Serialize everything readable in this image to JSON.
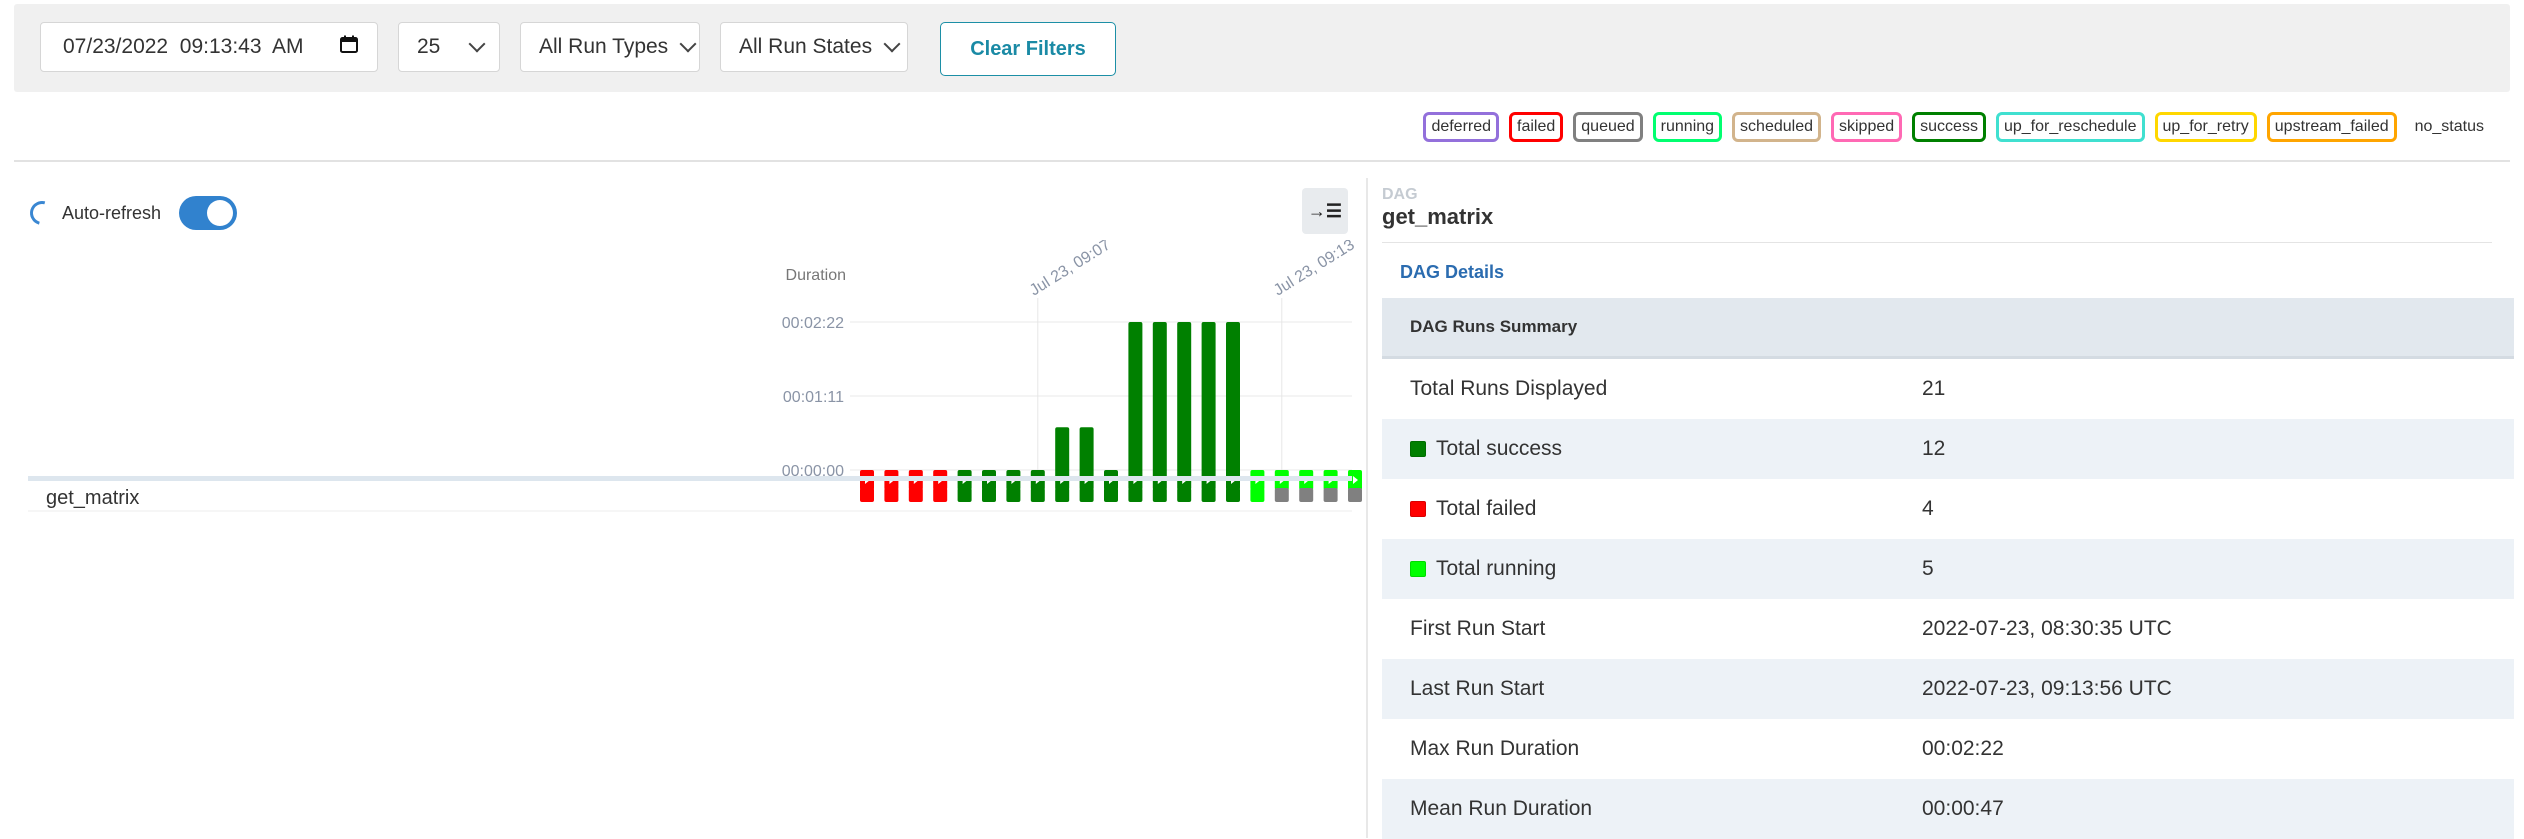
{
  "filters": {
    "execution_date": "07/23/2022  09:13:43  AM",
    "num_runs": "25",
    "run_type": "All Run Types",
    "run_state": "All Run States",
    "clear_label": "Clear Filters"
  },
  "legend": [
    {
      "label": "deferred",
      "color": "#9370db"
    },
    {
      "label": "failed",
      "color": "#ff0000"
    },
    {
      "label": "queued",
      "color": "#808080"
    },
    {
      "label": "running",
      "color": "#01ff70"
    },
    {
      "label": "scheduled",
      "color": "#d2b48c"
    },
    {
      "label": "skipped",
      "color": "#ff69b4"
    },
    {
      "label": "success",
      "color": "#008000"
    },
    {
      "label": "up_for_reschedule",
      "color": "#40e0d0"
    },
    {
      "label": "up_for_retry",
      "color": "#ffd700"
    },
    {
      "label": "upstream_failed",
      "color": "#ffa500"
    },
    {
      "label": "no_status",
      "color": ""
    }
  ],
  "auto_refresh": {
    "label": "Auto-refresh",
    "enabled": true
  },
  "grid": {
    "duration_label": "Duration",
    "y_ticks": [
      "00:02:22",
      "00:01:11",
      "00:00:00"
    ],
    "date_labels": [
      {
        "text": "Jul 23, 09:07",
        "run_index": 7
      },
      {
        "text": "Jul 23, 09:13",
        "run_index": 17
      }
    ],
    "task_name": "get_matrix",
    "max_duration_seconds": 142
  },
  "chart_data": {
    "type": "bar",
    "ylabel": "Duration",
    "ylim": [
      0,
      142
    ],
    "runs": [
      {
        "state": "failed",
        "duration": 0
      },
      {
        "state": "failed",
        "duration": 0
      },
      {
        "state": "failed",
        "duration": 0
      },
      {
        "state": "failed",
        "duration": 0
      },
      {
        "state": "success",
        "duration": 12
      },
      {
        "state": "success",
        "duration": 15
      },
      {
        "state": "success",
        "duration": 11
      },
      {
        "state": "success",
        "duration": 11
      },
      {
        "state": "success",
        "duration": 53
      },
      {
        "state": "success",
        "duration": 53
      },
      {
        "state": "success",
        "duration": 12
      },
      {
        "state": "success",
        "duration": 142
      },
      {
        "state": "success",
        "duration": 142
      },
      {
        "state": "success",
        "duration": 142
      },
      {
        "state": "success",
        "duration": 142
      },
      {
        "state": "success",
        "duration": 142
      },
      {
        "state": "running",
        "duration": 0
      },
      {
        "state": "running",
        "duration": 0
      },
      {
        "state": "running",
        "duration": 0
      },
      {
        "state": "running",
        "duration": 0
      },
      {
        "state": "running",
        "duration": 0
      }
    ],
    "task_instances": [
      "failed",
      "failed",
      "failed",
      "failed",
      "success",
      "success",
      "success",
      "success",
      "success",
      "success",
      "success",
      "success",
      "success",
      "success",
      "success",
      "success",
      "running",
      "queued",
      "queued",
      "queued",
      "queued"
    ]
  },
  "colors": {
    "failed": "#ff0000",
    "success": "#008000",
    "running": "#00ff00",
    "queued": "#808080"
  },
  "dag": {
    "section_label": "DAG",
    "dag_id": "get_matrix",
    "details_tab": "DAG Details",
    "summary_title": "DAG Runs Summary",
    "rows": [
      {
        "key": "Total Runs Displayed",
        "value": "21",
        "swatch": ""
      },
      {
        "key": "Total success",
        "value": "12",
        "swatch": "#008000"
      },
      {
        "key": "Total failed",
        "value": "4",
        "swatch": "#ff0000"
      },
      {
        "key": "Total running",
        "value": "5",
        "swatch": "#00ff00"
      },
      {
        "key": "First Run Start",
        "value": "2022-07-23, 08:30:35 UTC",
        "swatch": ""
      },
      {
        "key": "Last Run Start",
        "value": "2022-07-23, 09:13:56 UTC",
        "swatch": ""
      },
      {
        "key": "Max Run Duration",
        "value": "00:02:22",
        "swatch": ""
      },
      {
        "key": "Mean Run Duration",
        "value": "00:00:47",
        "swatch": ""
      }
    ]
  }
}
